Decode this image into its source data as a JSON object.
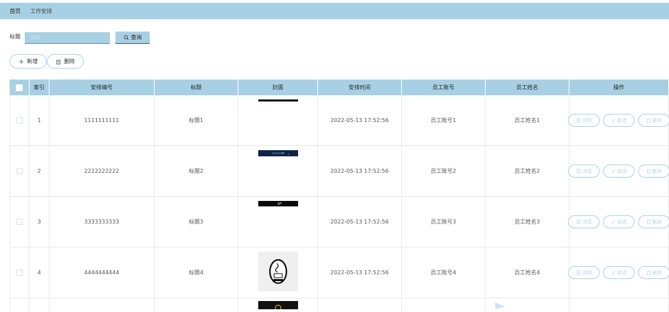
{
  "breadcrumb": {
    "home": "首页",
    "current": "工作安排"
  },
  "search": {
    "label": "标题",
    "placeholder": "标题",
    "button_label": "查询"
  },
  "actions": {
    "add_label": "新增",
    "delete_label": "删除"
  },
  "table": {
    "headers": [
      "索引",
      "安排编号",
      "标题",
      "封面",
      "安排时间",
      "员工账号",
      "员工姓名",
      "操作"
    ],
    "rows": [
      {
        "index": "1",
        "code": "1111111111",
        "title": "标题1",
        "time": "2022-05-13 17:52:56",
        "account": "员工账号1",
        "name": "员工姓名1"
      },
      {
        "index": "2",
        "code": "2222222222",
        "title": "标题2",
        "time": "2022-05-13 17:52:56",
        "account": "员工账号2",
        "name": "员工姓名2"
      },
      {
        "index": "3",
        "code": "3333333333",
        "title": "标题3",
        "time": "2022-05-13 17:52:56",
        "account": "员工账号3",
        "name": "员工姓名3"
      },
      {
        "index": "4",
        "code": "4444444444",
        "title": "标题4",
        "time": "2022-05-13 17:52:56",
        "account": "员工账号4",
        "name": "员工姓名4"
      }
    ],
    "row_ops": {
      "detail": "详情",
      "edit": "修改",
      "delete": "删除"
    }
  },
  "colors": {
    "accent": "#a8d0e4",
    "muted_text": "#b7d7e6"
  }
}
